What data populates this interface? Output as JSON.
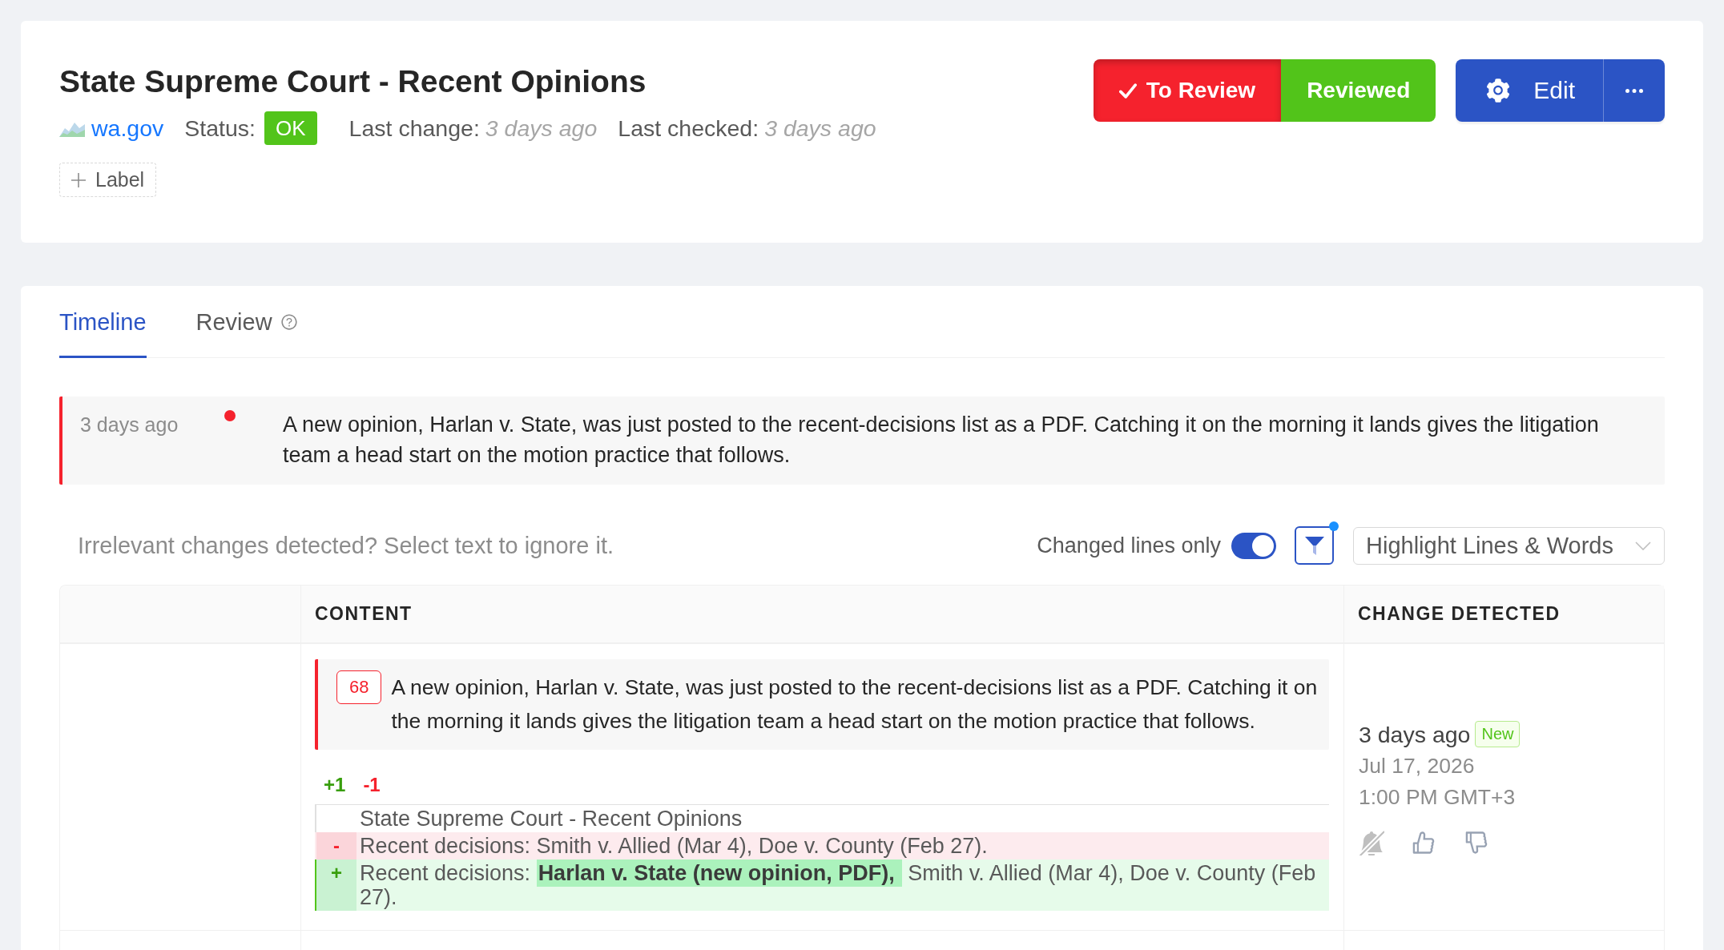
{
  "header": {
    "title": "State Supreme Court - Recent Opinions",
    "site": "wa.gov",
    "status": {
      "label": "Status:",
      "value": "OK"
    },
    "last_change": {
      "label": "Last change:",
      "value": "3 days ago"
    },
    "last_checked": {
      "label": "Last checked:",
      "value": "3 days ago"
    },
    "add_label_button": "Label",
    "review_states": [
      {
        "label": "To Review",
        "selected": true,
        "color": "#f5222d"
      },
      {
        "label": "Reviewed",
        "selected": false,
        "color": "#52c41a"
      }
    ],
    "edit_button": "Edit"
  },
  "tabs": [
    {
      "label": "Timeline",
      "selected": true,
      "help": false
    },
    {
      "label": "Review",
      "selected": false,
      "help": true
    }
  ],
  "timeline": [
    {
      "time": "3 days ago",
      "color": "#f5222d",
      "text": "A new opinion, Harlan v. State, was just posted to the recent-decisions list as a PDF. Catching it on the morning it lands gives the litigation team a head start on the motion practice that follows."
    }
  ],
  "filter_bar": {
    "hint": "Irrelevant changes detected? Select text to ignore it.",
    "changed_lines_only": {
      "label": "Changed lines only",
      "on": true
    },
    "filter_active": true,
    "highlight_mode": "Highlight Lines & Words"
  },
  "table": {
    "columns": [
      "CONTENT",
      "CHANGE DETECTED"
    ],
    "rows": [
      {
        "summary": {
          "line_number": "68",
          "text": "A new opinion, Harlan v. State, was just posted to the recent-decisions list as a PDF. Catching it on the morning it lands gives the litigation team a head start on the motion practice that follows."
        },
        "added_count": "+1",
        "removed_count": "-1",
        "diff": [
          {
            "kind": "context",
            "text": "State Supreme Court - Recent Opinions"
          },
          {
            "kind": "removed",
            "marker": "-",
            "text": "Recent decisions: Smith v. Allied (Mar 4), Doe v. County (Feb 27)."
          },
          {
            "kind": "added",
            "marker": "+",
            "text": "Recent decisions: **Harlan v. State (new opinion, PDF),** Smith v. Allied (Mar 4), Doe v. County (Feb 27)."
          }
        ],
        "detected": {
          "relative": "3 days ago",
          "tag": "New",
          "date": "Jul 17, 2026",
          "time": "1:00 PM GMT+3"
        }
      }
    ]
  }
}
